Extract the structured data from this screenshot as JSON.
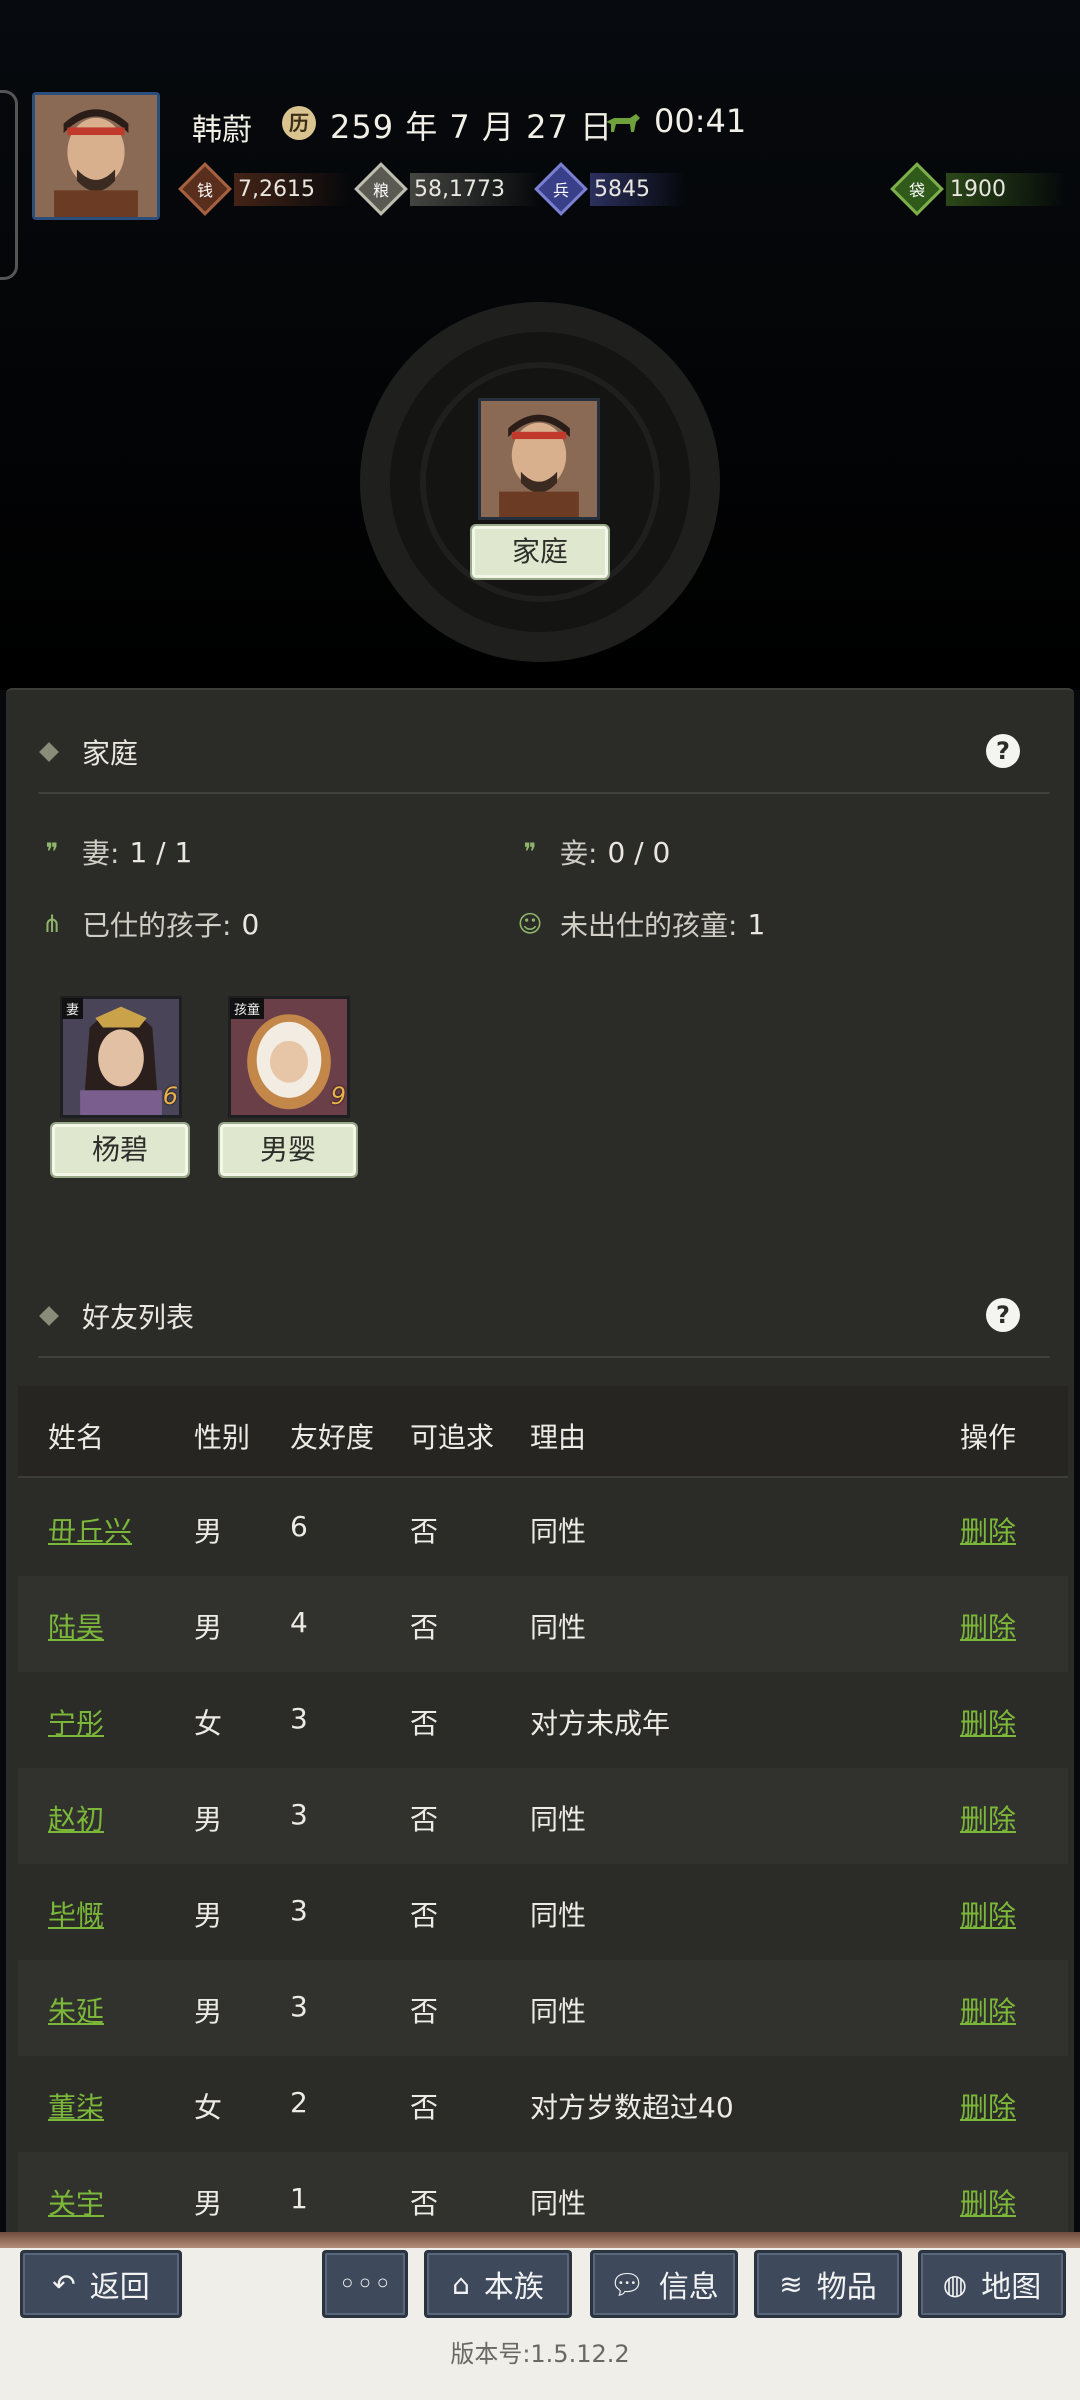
{
  "header": {
    "player_name": "韩蔚",
    "date": "259 年 7 月 27 日",
    "time": "00:41",
    "resources": {
      "money": "7,2615",
      "food": "58,1773",
      "soldiers": "5845",
      "bag": "1900"
    },
    "center_label": "家庭"
  },
  "family": {
    "title": "家庭",
    "help": "?",
    "wife_label": "妻:",
    "wife_value": "1 / 1",
    "concubine_label": "妾:",
    "concubine_value": "0 / 0",
    "employed_children_label": "已仕的孩子:",
    "employed_children_value": "0",
    "unemployed_children_label": "未出仕的孩童:",
    "unemployed_children_value": "1",
    "members": [
      {
        "tag": "妻",
        "name": "杨碧",
        "age": "6"
      },
      {
        "tag": "孩童",
        "name": "男婴",
        "age": "9"
      }
    ]
  },
  "friends": {
    "title": "好友列表",
    "help": "?",
    "columns": [
      "姓名",
      "性别",
      "友好度",
      "可追求",
      "理由",
      "操作"
    ],
    "rows": [
      {
        "name": "毌丘兴",
        "sex": "男",
        "favor": "6",
        "pursue": "否",
        "reason": "同性",
        "action": "删除"
      },
      {
        "name": "陆昊",
        "sex": "男",
        "favor": "4",
        "pursue": "否",
        "reason": "同性",
        "action": "删除"
      },
      {
        "name": "宁彤",
        "sex": "女",
        "favor": "3",
        "pursue": "否",
        "reason": "对方未成年",
        "action": "删除"
      },
      {
        "name": "赵初",
        "sex": "男",
        "favor": "3",
        "pursue": "否",
        "reason": "同性",
        "action": "删除"
      },
      {
        "name": "毕慨",
        "sex": "男",
        "favor": "3",
        "pursue": "否",
        "reason": "同性",
        "action": "删除"
      },
      {
        "name": "朱延",
        "sex": "男",
        "favor": "3",
        "pursue": "否",
        "reason": "同性",
        "action": "删除"
      },
      {
        "name": "董柒",
        "sex": "女",
        "favor": "2",
        "pursue": "否",
        "reason": "对方岁数超过40",
        "action": "删除"
      },
      {
        "name": "关宇",
        "sex": "男",
        "favor": "1",
        "pursue": "否",
        "reason": "同性",
        "action": "删除"
      }
    ]
  },
  "bottom_bar": {
    "back": "返回",
    "more": "◦◦◦",
    "clan": "本族",
    "info": "信息",
    "items": "物品",
    "map": "地图",
    "version": "版本号:1.5.12.2"
  },
  "colors": {
    "link_green": "#7bb83a",
    "panel_bg": "#2b2c28",
    "button_bg": "#3e4a5c"
  }
}
